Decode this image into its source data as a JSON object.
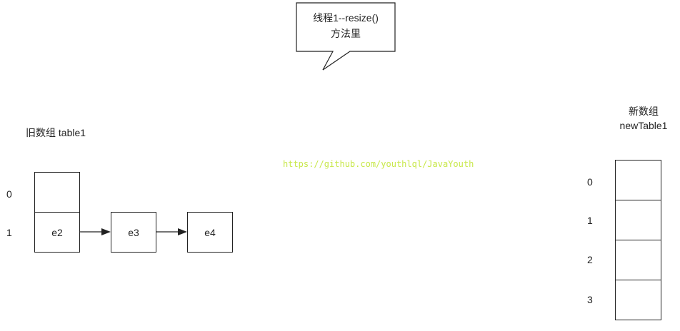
{
  "callout": {
    "line1": "线程1--resize()",
    "line2": "方法里"
  },
  "old_table": {
    "title": "旧数组 table1",
    "indices": [
      "0",
      "1"
    ],
    "chain": [
      "e2",
      "e3",
      "e4"
    ]
  },
  "new_table": {
    "title_line1": "新数组",
    "title_line2": "newTable1",
    "indices": [
      "0",
      "1",
      "2",
      "3"
    ]
  },
  "watermark": {
    "text": "https://github.com/youthlql/JavaYouth",
    "color": "#c8e84a"
  }
}
